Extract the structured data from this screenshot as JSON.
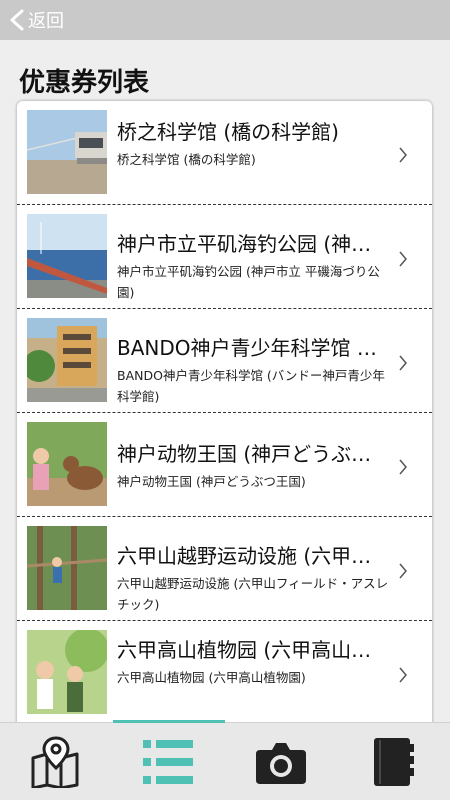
{
  "nav": {
    "back_label": "返回"
  },
  "page": {
    "title": "优惠券列表"
  },
  "coupons": [
    {
      "title": "桥之科学馆 (橋の科学館)",
      "subtitle": "桥之科学馆 (橋の科学館)"
    },
    {
      "title": "神户市立平矶海钓公园 (神…",
      "subtitle": "神户市立平矶海钓公园 (神戸市立 平磯海づり公園)"
    },
    {
      "title": "BANDO神户青少年科学馆 …",
      "subtitle": "BANDO神户青少年科学馆 (バンドー神戸青少年科学館)"
    },
    {
      "title": "神户动物王国 (神戸どうぶ…",
      "subtitle": "神户动物王国 (神戸どうぶつ王国)"
    },
    {
      "title": "六甲山越野运动设施 (六甲…",
      "subtitle": "六甲山越野运动设施 (六甲山フィールド・アスレチック)"
    },
    {
      "title": "六甲高山植物园 (六甲高山…",
      "subtitle": "六甲高山植物园 (六甲高山植物園)"
    }
  ],
  "tabs": [
    {
      "icon": "map-pin-icon",
      "selected": false
    },
    {
      "icon": "list-icon",
      "selected": true
    },
    {
      "icon": "camera-icon",
      "selected": false
    },
    {
      "icon": "notebook-icon",
      "selected": false
    }
  ],
  "colors": {
    "accent": "#4fc0b4",
    "topbar": "#c9c9c9",
    "icon": "#222222"
  }
}
